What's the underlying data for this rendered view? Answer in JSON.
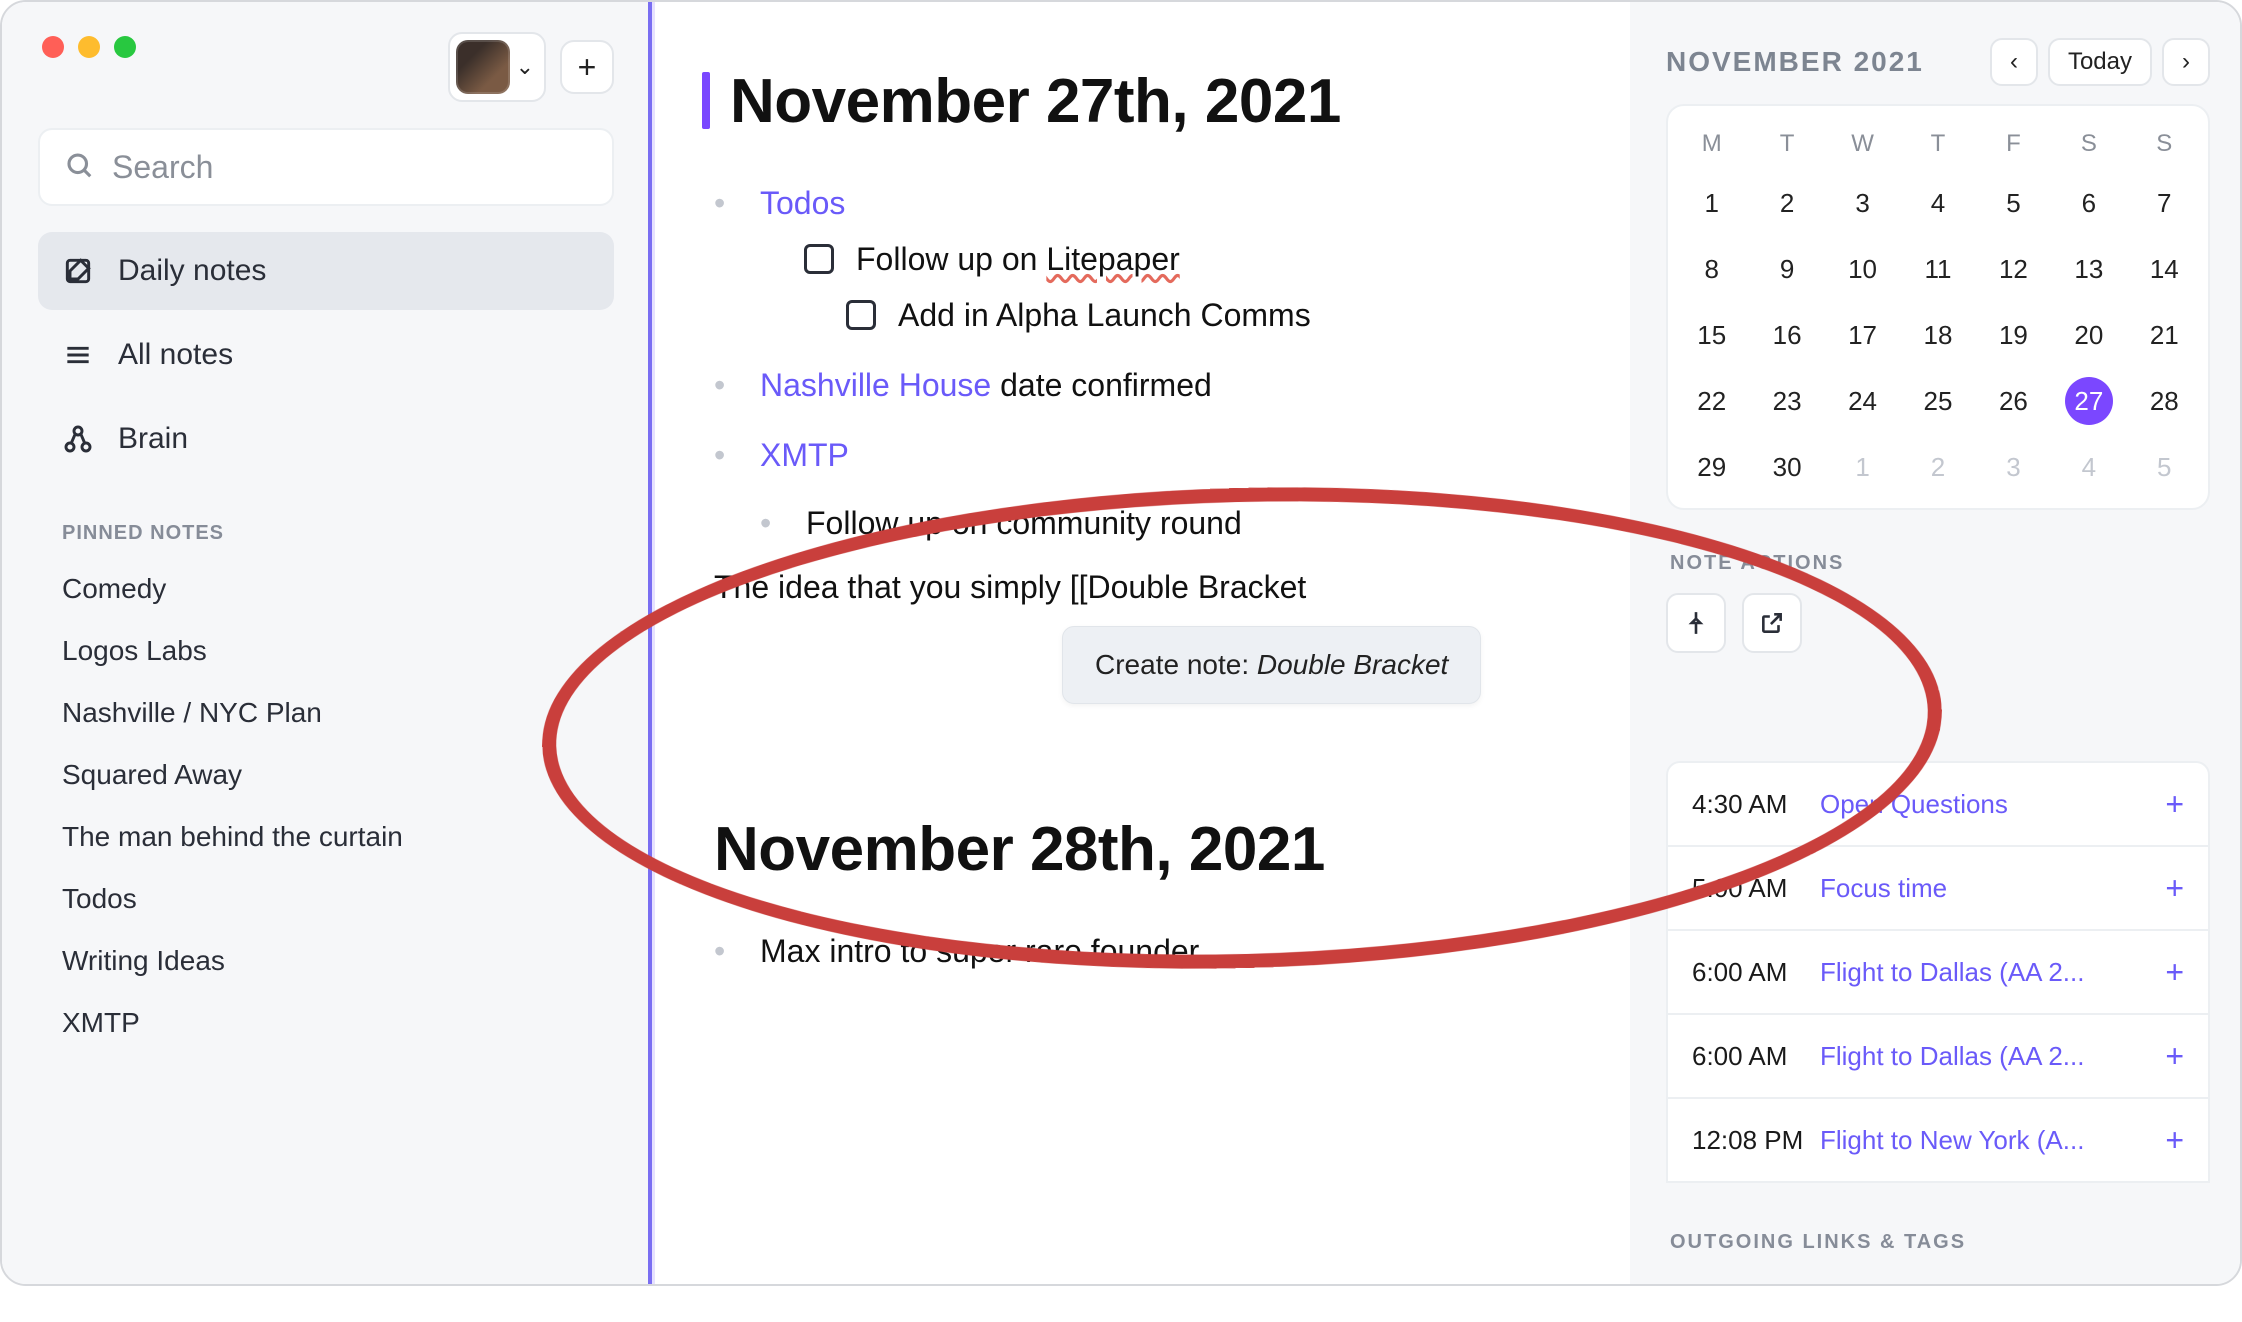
{
  "sidebar": {
    "search_placeholder": "Search",
    "nav": {
      "daily": "Daily notes",
      "all": "All notes",
      "brain": "Brain"
    },
    "pinned_header": "PINNED NOTES",
    "pinned": [
      "Comedy",
      "Logos Labs",
      "Nashville / NYC Plan",
      "Squared Away",
      "The man behind the curtain",
      "Todos",
      "Writing Ideas",
      "XMTP"
    ]
  },
  "editor": {
    "day1": {
      "title": "November 27th, 2021",
      "todos_link": "Todos",
      "todo1_prefix": "Follow up on ",
      "todo1_spelled": "Litepaper",
      "todo2": "Add in Alpha Launch Comms",
      "nashville_link": "Nashville House",
      "nashville_suffix": " date confirmed",
      "xmtp_link": "XMTP",
      "xmtp_sub": "Follow up on community round",
      "free_line": "The idea that you simply [[Double Bracket",
      "popup_prefix": "Create note: ",
      "popup_name": "Double Bracket"
    },
    "day2": {
      "title": "November 28th, 2021",
      "item1": "Max intro to super rare founder"
    }
  },
  "right": {
    "cal_title": "NOVEMBER 2021",
    "today_label": "Today",
    "dow": [
      "M",
      "T",
      "W",
      "T",
      "F",
      "S",
      "S"
    ],
    "weeks": [
      [
        {
          "n": "1"
        },
        {
          "n": "2"
        },
        {
          "n": "3"
        },
        {
          "n": "4"
        },
        {
          "n": "5"
        },
        {
          "n": "6"
        },
        {
          "n": "7"
        }
      ],
      [
        {
          "n": "8"
        },
        {
          "n": "9"
        },
        {
          "n": "10"
        },
        {
          "n": "11"
        },
        {
          "n": "12"
        },
        {
          "n": "13"
        },
        {
          "n": "14"
        }
      ],
      [
        {
          "n": "15"
        },
        {
          "n": "16"
        },
        {
          "n": "17"
        },
        {
          "n": "18"
        },
        {
          "n": "19"
        },
        {
          "n": "20"
        },
        {
          "n": "21"
        }
      ],
      [
        {
          "n": "22"
        },
        {
          "n": "23"
        },
        {
          "n": "24"
        },
        {
          "n": "25"
        },
        {
          "n": "26"
        },
        {
          "n": "27",
          "sel": true
        },
        {
          "n": "28"
        }
      ],
      [
        {
          "n": "29"
        },
        {
          "n": "30"
        },
        {
          "n": "1",
          "mute": true
        },
        {
          "n": "2",
          "mute": true
        },
        {
          "n": "3",
          "mute": true
        },
        {
          "n": "4",
          "mute": true
        },
        {
          "n": "5",
          "mute": true
        }
      ]
    ],
    "note_actions_header": "NOTE ACTIONS",
    "events": [
      {
        "time": "4:30 AM",
        "title": "Open Questions"
      },
      {
        "time": "5:00 AM",
        "title": "Focus time"
      },
      {
        "time": "6:00 AM",
        "title": "Flight to Dallas (AA 2..."
      },
      {
        "time": "6:00 AM",
        "title": "Flight to Dallas (AA 2..."
      },
      {
        "time": "12:08 PM",
        "title": "Flight to New York (A..."
      }
    ],
    "outgoing_header": "OUTGOING LINKS & TAGS"
  }
}
